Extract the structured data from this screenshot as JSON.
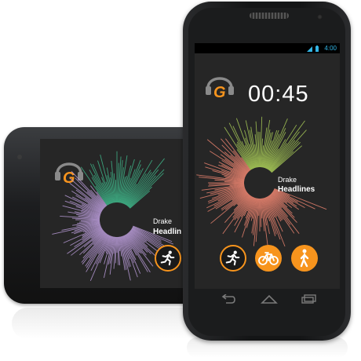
{
  "colors": {
    "accent": "#f7941d",
    "screen_bg": "#262626",
    "status_blue": "#33b5e5",
    "burst_front_warm": "#e8836f",
    "burst_front_green": "#a7c957",
    "burst_back_purple": "#b79ad6",
    "burst_back_green": "#3fb68a"
  },
  "front": {
    "status_time": "4:00",
    "logo_letter": "G",
    "timer": "00:45",
    "track": {
      "artist": "Drake",
      "title": "Headlines"
    },
    "modes": [
      {
        "icon": "running-icon",
        "state": "selected"
      },
      {
        "icon": "cycling-icon",
        "state": "filled"
      },
      {
        "icon": "walking-icon",
        "state": "filled"
      }
    ],
    "nav": [
      "back-icon",
      "home-icon",
      "recent-apps-icon"
    ]
  },
  "back": {
    "logo_letter": "G",
    "track": {
      "artist": "Drake",
      "title": "Headlin"
    },
    "modes": [
      {
        "icon": "running-icon",
        "state": "selected"
      }
    ]
  }
}
